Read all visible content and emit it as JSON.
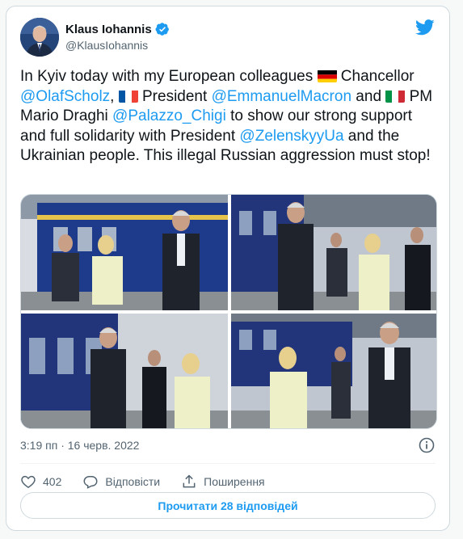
{
  "author": {
    "name": "Klaus Iohannis",
    "handle": "@KlausIohannis",
    "verified": true,
    "avatar_icon": "avatar-portrait"
  },
  "tweet": {
    "segments": [
      {
        "type": "text",
        "value": "In Kyiv today with my European colleagues "
      },
      {
        "type": "flag",
        "value": "germany-flag"
      },
      {
        "type": "text",
        "value": " Chancellor "
      },
      {
        "type": "mention",
        "value": "@OlafScholz"
      },
      {
        "type": "text",
        "value": ", "
      },
      {
        "type": "flag",
        "value": "france-flag"
      },
      {
        "type": "text",
        "value": " President "
      },
      {
        "type": "mention",
        "value": "@EmmanuelMacron"
      },
      {
        "type": "text",
        "value": " and "
      },
      {
        "type": "flag",
        "value": "italy-flag"
      },
      {
        "type": "text",
        "value": " PM Mario Draghi "
      },
      {
        "type": "mention",
        "value": "@Palazzo_Chigi"
      },
      {
        "type": "text",
        "value": " to show our strong support and full solidarity with President "
      },
      {
        "type": "mention",
        "value": "@ZelenskyyUa"
      },
      {
        "type": "text",
        "value": " and the Ukrainian people. This illegal Russian aggression must stop!"
      }
    ]
  },
  "photos": [
    "photo-1",
    "photo-2",
    "photo-3",
    "photo-4"
  ],
  "timestamp": "3:19 пп · 16 черв. 2022",
  "actions": {
    "likes": "402",
    "reply_label": "Відповісти",
    "share_label": "Поширення"
  },
  "read_replies_label": "Прочитати 28 відповідей",
  "colors": {
    "accent": "#1d9bf0",
    "text": "#0f1419",
    "muted": "#536471",
    "border": "#cfd9de"
  }
}
